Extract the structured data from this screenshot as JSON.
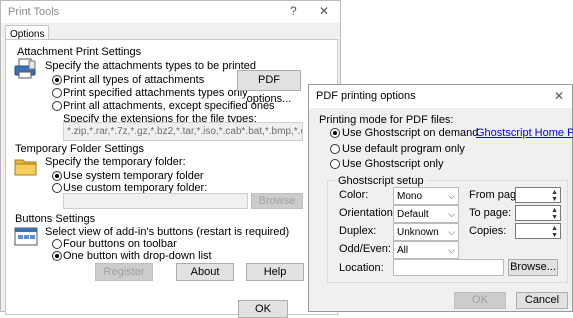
{
  "print_tools": {
    "title": "Print Tools",
    "help_btn": "?",
    "close_btn": "✕",
    "tab_options": "Options",
    "attachment": {
      "heading": "Attachment Print Settings",
      "prompt": "Specify the attachments types to be printed",
      "options": [
        "Print all types of attachments",
        "Print specified attachments types only",
        "Print all attachments, except specified ones"
      ],
      "selected": 0,
      "pdf_button": "PDF options...",
      "ext_label": "Specify the extensions for the file types:",
      "ext_value": "*.zip,*.rar,*.7z,*.gz,*.bz2,*.tar,*.iso,*.cab*.bat,*.bmp,*.cmd,*.cc"
    },
    "temp": {
      "heading": "Temporary Folder Settings",
      "prompt": "Specify the temporary folder:",
      "options": [
        "Use system temporary folder",
        "Use custom temporary folder:"
      ],
      "selected": 0,
      "browse": "Browse"
    },
    "buttons_settings": {
      "heading": "Buttons Settings",
      "prompt": "Select view of add-in's buttons (restart is required)",
      "options": [
        "Four buttons on toolbar",
        "One button with drop-down list"
      ],
      "selected": 1
    },
    "register": "Register",
    "about": "About",
    "help": "Help",
    "ok": "OK"
  },
  "pdf_dialog": {
    "title": "PDF printing options",
    "close_btn": "✕",
    "mode_label": "Printing mode for PDF files:",
    "modes": [
      "Use Ghostscript on demand",
      "Use default program only",
      "Use Ghostscript only"
    ],
    "selected_mode": 0,
    "home_link": "Ghostscript Home Page",
    "setup_label": "Ghostscript setup",
    "color_label": "Color:",
    "color_value": "Mono",
    "orientation_label": "Orientation:",
    "orientation_value": "Default",
    "duplex_label": "Duplex:",
    "duplex_value": "Unknown",
    "oddeven_label": "Odd/Even:",
    "oddeven_value": "All",
    "location_label": "Location:",
    "browse": "Browse...",
    "from_page_label": "From page:",
    "to_page_label": "To page:",
    "copies_label": "Copies:",
    "ok": "OK",
    "cancel": "Cancel"
  }
}
